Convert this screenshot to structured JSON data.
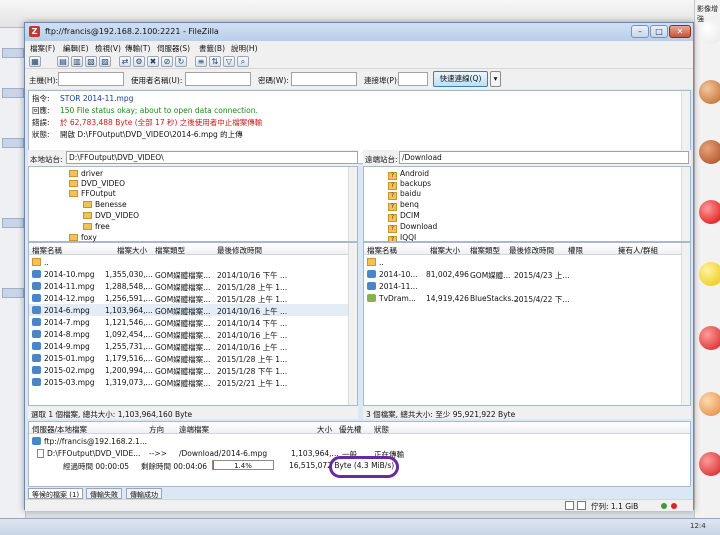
{
  "window": {
    "title": "ftp://francis@192.168.2.100:2221 - FileZilla",
    "menu": [
      "檔案(F)",
      "編輯(E)",
      "檢視(V)",
      "傳輸(T)",
      "伺服器(S)",
      "書籤(B)",
      "說明(H)"
    ]
  },
  "quickconnect": {
    "host_label": "主機(H):",
    "user_label": "使用者名稱(U):",
    "pass_label": "密碼(W):",
    "port_label": "連接埠(P):",
    "button": "快速連線(Q)",
    "dropdown": "▾"
  },
  "log": [
    {
      "key": "指令:",
      "text": "STOR 2014-11.mpg",
      "color": "#1a3a9c"
    },
    {
      "key": "回應:",
      "text": "150 File status okay; about to open data connection.",
      "color": "#1a8a1a"
    },
    {
      "key": "錯誤:",
      "text": "於 62,783,488 Byte (全部 17 秒) 之後使用者中止檔案傳輸",
      "color": "#d11a1a"
    },
    {
      "key": "狀態:",
      "text": "開啟 D:\\FFOutput\\DVD_VIDEO\\2014-6.mpg 的上傳",
      "color": "#111111"
    }
  ],
  "local": {
    "path_label": "本地站台:",
    "path": "D:\\FFOutput\\DVD_VIDEO\\",
    "tree": [
      {
        "name": "driver",
        "level": 1
      },
      {
        "name": "DVD_VIDEO",
        "level": 1
      },
      {
        "name": "FFOutput",
        "level": 1
      },
      {
        "name": "Benesse",
        "level": 2
      },
      {
        "name": "DVD_VIDEO",
        "level": 2
      },
      {
        "name": "free",
        "level": 2
      },
      {
        "name": "foxy",
        "level": 1
      }
    ],
    "columns": [
      "檔案名稱",
      "檔案大小",
      "檔案類型",
      "最後修改時間"
    ],
    "parent": "..",
    "files": [
      {
        "name": "2014-10.mpg",
        "size": "1,355,030,...",
        "type": "GOM媒體檔案...",
        "modified": "2014/10/16 下午 ..."
      },
      {
        "name": "2014-11.mpg",
        "size": "1,288,548,...",
        "type": "GOM媒體檔案...",
        "modified": "2015/1/28 上午 1..."
      },
      {
        "name": "2014-12.mpg",
        "size": "1,256,591,...",
        "type": "GOM媒體檔案...",
        "modified": "2015/1/28 上午 1..."
      },
      {
        "name": "2014-6.mpg",
        "size": "1,103,964,...",
        "type": "GOM媒體檔案...",
        "modified": "2014/10/16 上午 ..."
      },
      {
        "name": "2014-7.mpg",
        "size": "1,121,546,...",
        "type": "GOM媒體檔案...",
        "modified": "2014/10/14 下午 ..."
      },
      {
        "name": "2014-8.mpg",
        "size": "1,092,454,...",
        "type": "GOM媒體檔案...",
        "modified": "2014/10/16 上午 ..."
      },
      {
        "name": "2014-9.mpg",
        "size": "1,255,731,...",
        "type": "GOM媒體檔案...",
        "modified": "2014/10/16 上午 ..."
      },
      {
        "name": "2015-01.mpg",
        "size": "1,179,516,...",
        "type": "GOM媒體檔案...",
        "modified": "2015/1/28 上午 1..."
      },
      {
        "name": "2015-02.mpg",
        "size": "1,200,994,...",
        "type": "GOM媒體檔案...",
        "modified": "2015/1/28 下午 1..."
      },
      {
        "name": "2015-03.mpg",
        "size": "1,319,073,...",
        "type": "GOM媒體檔案...",
        "modified": "2015/2/21 上午 1..."
      }
    ],
    "status": "選取 1 個檔案, 總共大小: 1,103,964,160 Byte"
  },
  "remote": {
    "path_label": "遠端站台:",
    "path": "/Download",
    "tree": [
      "Android",
      "backups",
      "baidu",
      "benq",
      "DCIM",
      "Download",
      "IQQI"
    ],
    "columns": [
      "檔案名稱",
      "檔案大小",
      "檔案類型",
      "最後修改時間",
      "權限",
      "擁有人/群組"
    ],
    "parent": "..",
    "files": [
      {
        "name": "2014-10...",
        "size": "81,002,496",
        "type": "GOM媒體...",
        "modified": "2015/4/23 上...",
        "icon": "mpg"
      },
      {
        "name": "2014-11...",
        "size": "",
        "type": "",
        "modified": "",
        "icon": "mpg"
      },
      {
        "name": "TvDram...",
        "size": "14,919,426",
        "type": "BlueStacks...",
        "modified": "2015/4/22 下...",
        "icon": "tv"
      }
    ],
    "status": "3 個檔案, 總共大小: 至少 95,921,922 Byte"
  },
  "queue": {
    "columns": [
      "伺服器/本地檔案",
      "方向",
      "遠端檔案",
      "大小",
      "優先權",
      "狀態"
    ],
    "server": "ftp://francis@192.168.2.1...",
    "local_file": "D:\\FFOutput\\DVD_VIDE...",
    "direction": "-->>",
    "remote_file": "/Download/2014-6.mpg",
    "size": "1,103,964,...",
    "priority": "一般",
    "state": "正在傳輸",
    "elapsed": "經過時間 00:00:05",
    "remaining": "剩餘時間 00:04:06",
    "progress_text": "1.4%",
    "progress": 0.014,
    "transferred": "16,515,072 Byte (4.3 MiB/s)",
    "tabs": [
      "等候的檔案 (1)",
      "傳輸失敗",
      "傳輸成功"
    ],
    "queue_size": "佇列: 1.1 GiB"
  },
  "desktop": {
    "right_labels": [
      "強",
      "紅色",
      "紅色",
      "色",
      "黃色",
      "紅色",
      "色",
      "紅色",
      "色 1",
      "紅色",
      "色"
    ],
    "right_header": "影像增強",
    "clock": "12:4"
  }
}
